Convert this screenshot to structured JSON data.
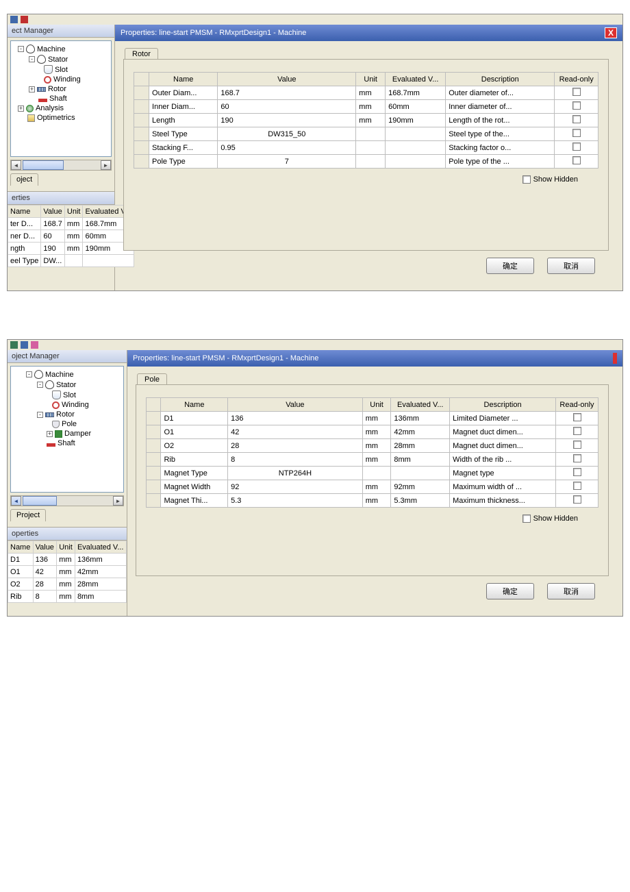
{
  "labels": {
    "project_manager": "ect Manager",
    "project_manager2": "oject Manager",
    "project_tab": "oject",
    "project_tab2": "Project",
    "properties_tab": "erties",
    "properties_tab2": "operties",
    "tree1": {
      "machine": "Machine",
      "stator": "Stator",
      "slot": "Slot",
      "winding": "Winding",
      "rotor": "Rotor",
      "shaft": "Shaft",
      "analysis": "Analysis",
      "optimetrics": "Optimetrics"
    },
    "tree2": {
      "machine": "Machine",
      "stator": "Stator",
      "slot": "Slot",
      "winding": "Winding",
      "rotor": "Rotor",
      "pole": "Pole",
      "damper": "Damper",
      "shaft": "Shaft"
    },
    "left_headers": {
      "name": "Name",
      "value": "Value",
      "unit": "Unit",
      "eval": "Evaluated V..."
    },
    "prop_headers": {
      "name": "Name",
      "value": "Value",
      "unit": "Unit",
      "eval": "Evaluated V...",
      "desc": "Description",
      "ro": "Read-only"
    },
    "dialog_title": "Properties: line-start PMSM - RMxprtDesign1 - Machine",
    "tab_rotor": "Rotor",
    "tab_pole": "Pole",
    "show_hidden": "Show Hidden",
    "ok": "确定",
    "cancel": "取消"
  },
  "left_rows1": [
    {
      "name": "ter D...",
      "value": "168.7",
      "unit": "mm",
      "eval": "168.7mm"
    },
    {
      "name": "ner D...",
      "value": "60",
      "unit": "mm",
      "eval": "60mm"
    },
    {
      "name": "ngth",
      "value": "190",
      "unit": "mm",
      "eval": "190mm"
    },
    {
      "name": "eel Type",
      "value": "DW...",
      "unit": "",
      "eval": ""
    }
  ],
  "left_rows2": [
    {
      "name": "D1",
      "value": "136",
      "unit": "mm",
      "eval": "136mm"
    },
    {
      "name": "O1",
      "value": "42",
      "unit": "mm",
      "eval": "42mm"
    },
    {
      "name": "O2",
      "value": "28",
      "unit": "mm",
      "eval": "28mm"
    },
    {
      "name": "Rib",
      "value": "8",
      "unit": "mm",
      "eval": "8mm"
    }
  ],
  "prop_rows1": [
    {
      "name": "Outer Diam...",
      "value": "168.7",
      "unit": "mm",
      "eval": "168.7mm",
      "desc": "Outer diameter of..."
    },
    {
      "name": "Inner Diam...",
      "value": "60",
      "unit": "mm",
      "eval": "60mm",
      "desc": "Inner diameter of..."
    },
    {
      "name": "Length",
      "value": "190",
      "unit": "mm",
      "eval": "190mm",
      "desc": "Length of the rot..."
    },
    {
      "name": "Steel Type",
      "value": "DW315_50",
      "unit": "",
      "eval": "",
      "desc": "Steel type of the...",
      "center": true
    },
    {
      "name": "Stacking F...",
      "value": "0.95",
      "unit": "",
      "eval": "",
      "desc": "Stacking factor o..."
    },
    {
      "name": "Pole Type",
      "value": "7",
      "unit": "",
      "eval": "",
      "desc": "Pole type of the ...",
      "center": true
    }
  ],
  "prop_rows2": [
    {
      "name": "D1",
      "value": "136",
      "unit": "mm",
      "eval": "136mm",
      "desc": "Limited Diameter ..."
    },
    {
      "name": "O1",
      "value": "42",
      "unit": "mm",
      "eval": "42mm",
      "desc": "Magnet duct dimen..."
    },
    {
      "name": "O2",
      "value": "28",
      "unit": "mm",
      "eval": "28mm",
      "desc": "Magnet duct dimen..."
    },
    {
      "name": "Rib",
      "value": "8",
      "unit": "mm",
      "eval": "8mm",
      "desc": "Width of the rib ..."
    },
    {
      "name": "Magnet Type",
      "value": "NTP264H",
      "unit": "",
      "eval": "",
      "desc": "Magnet type",
      "center": true
    },
    {
      "name": "Magnet Width",
      "value": "92",
      "unit": "mm",
      "eval": "92mm",
      "desc": "Maximum width of ..."
    },
    {
      "name": "Magnet Thi...",
      "value": "5.3",
      "unit": "mm",
      "eval": "5.3mm",
      "desc": "Maximum thickness..."
    }
  ]
}
